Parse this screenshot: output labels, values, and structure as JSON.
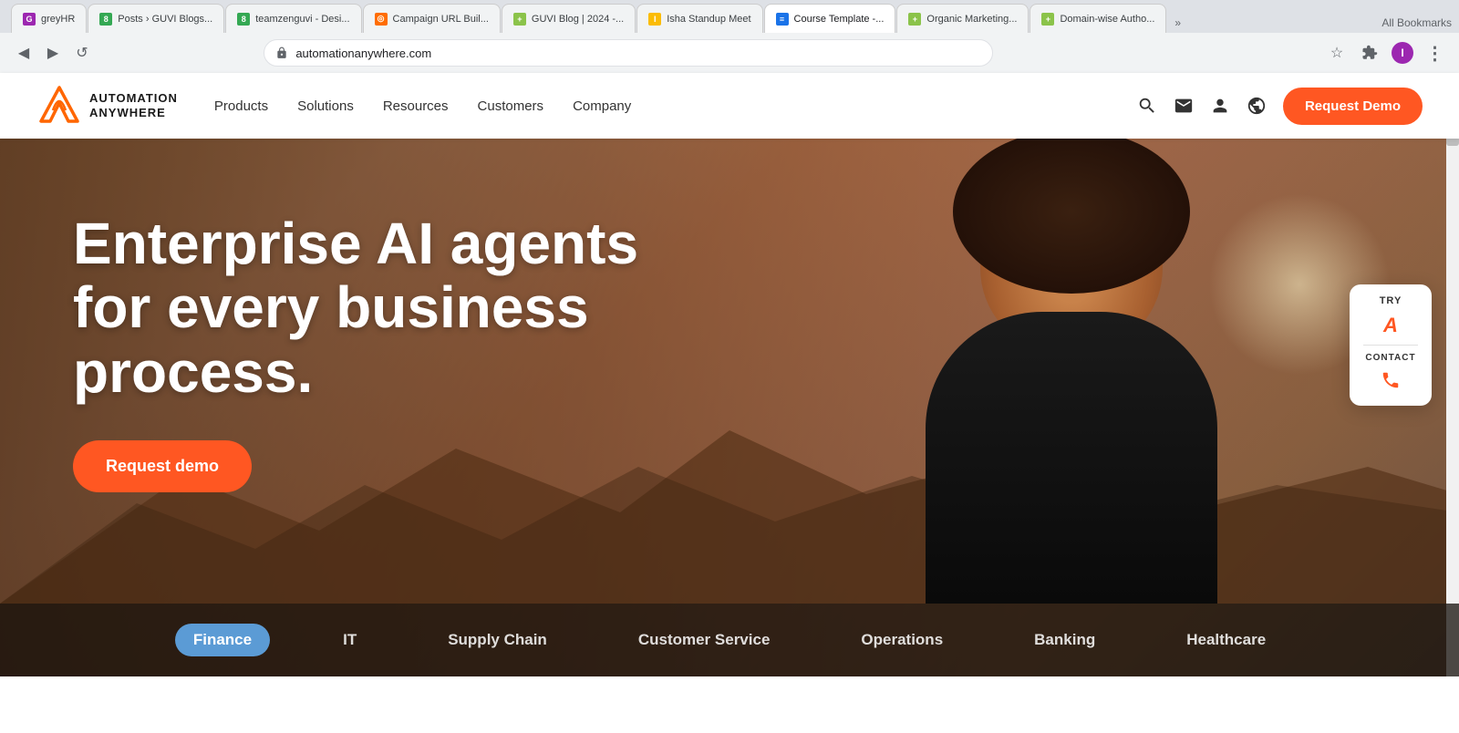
{
  "browser": {
    "url": "automationanywhere.com",
    "back_btn": "◀",
    "forward_btn": "▶",
    "refresh_btn": "↺",
    "star_icon": "☆",
    "extensions_icon": "⬜",
    "profile_icon": "👤",
    "menu_icon": "⋮",
    "bookmarks_label": "All Bookmarks"
  },
  "tabs": [
    {
      "id": "t1",
      "favicon_class": "purple",
      "favicon_text": "G",
      "label": "greyHR",
      "active": false
    },
    {
      "id": "t2",
      "favicon_class": "green",
      "favicon_text": "8",
      "label": "Posts › GUVI Blogs...",
      "active": false
    },
    {
      "id": "t3",
      "favicon_class": "green",
      "favicon_text": "8",
      "label": "teamzenguvi - Desi...",
      "active": false
    },
    {
      "id": "t4",
      "favicon_class": "orange",
      "favicon_text": "◎",
      "label": "Campaign URL Buil...",
      "active": false
    },
    {
      "id": "t5",
      "favicon_class": "lime",
      "favicon_text": "+",
      "label": "GUVI Blog | 2024 -...",
      "active": false
    },
    {
      "id": "t6",
      "favicon_class": "yellow",
      "favicon_text": "I",
      "label": "Isha Standup Meet",
      "active": false
    },
    {
      "id": "t7",
      "favicon_class": "blue",
      "favicon_text": "≡",
      "label": "Course Template -...",
      "active": true
    },
    {
      "id": "t8",
      "favicon_class": "lime",
      "favicon_text": "+",
      "label": "Organic Marketing...",
      "active": false
    },
    {
      "id": "t9",
      "favicon_class": "lime",
      "favicon_text": "+",
      "label": "Domain-wise Autho...",
      "active": false
    }
  ],
  "nav": {
    "logo_text_line1": "AUTOMATION",
    "logo_text_line2": "ANYWHERE",
    "links": [
      {
        "id": "products",
        "label": "Products"
      },
      {
        "id": "solutions",
        "label": "Solutions"
      },
      {
        "id": "resources",
        "label": "Resources"
      },
      {
        "id": "customers",
        "label": "Customers"
      },
      {
        "id": "company",
        "label": "Company"
      }
    ],
    "request_demo_label": "Request Demo"
  },
  "hero": {
    "headline_line1": "Enterprise AI agents",
    "headline_line2": "for every business process.",
    "cta_label": "Request demo"
  },
  "floating_widget": {
    "try_label": "TRY",
    "logo_letter": "A",
    "contact_label": "CONTACT"
  },
  "categories": [
    {
      "id": "finance",
      "label": "Finance",
      "active": true
    },
    {
      "id": "it",
      "label": "IT",
      "active": false
    },
    {
      "id": "supply_chain",
      "label": "Supply Chain",
      "active": false
    },
    {
      "id": "customer_service",
      "label": "Customer Service",
      "active": false
    },
    {
      "id": "operations",
      "label": "Operations",
      "active": false
    },
    {
      "id": "banking",
      "label": "Banking",
      "active": false
    },
    {
      "id": "healthcare",
      "label": "Healthcare",
      "active": false
    }
  ]
}
